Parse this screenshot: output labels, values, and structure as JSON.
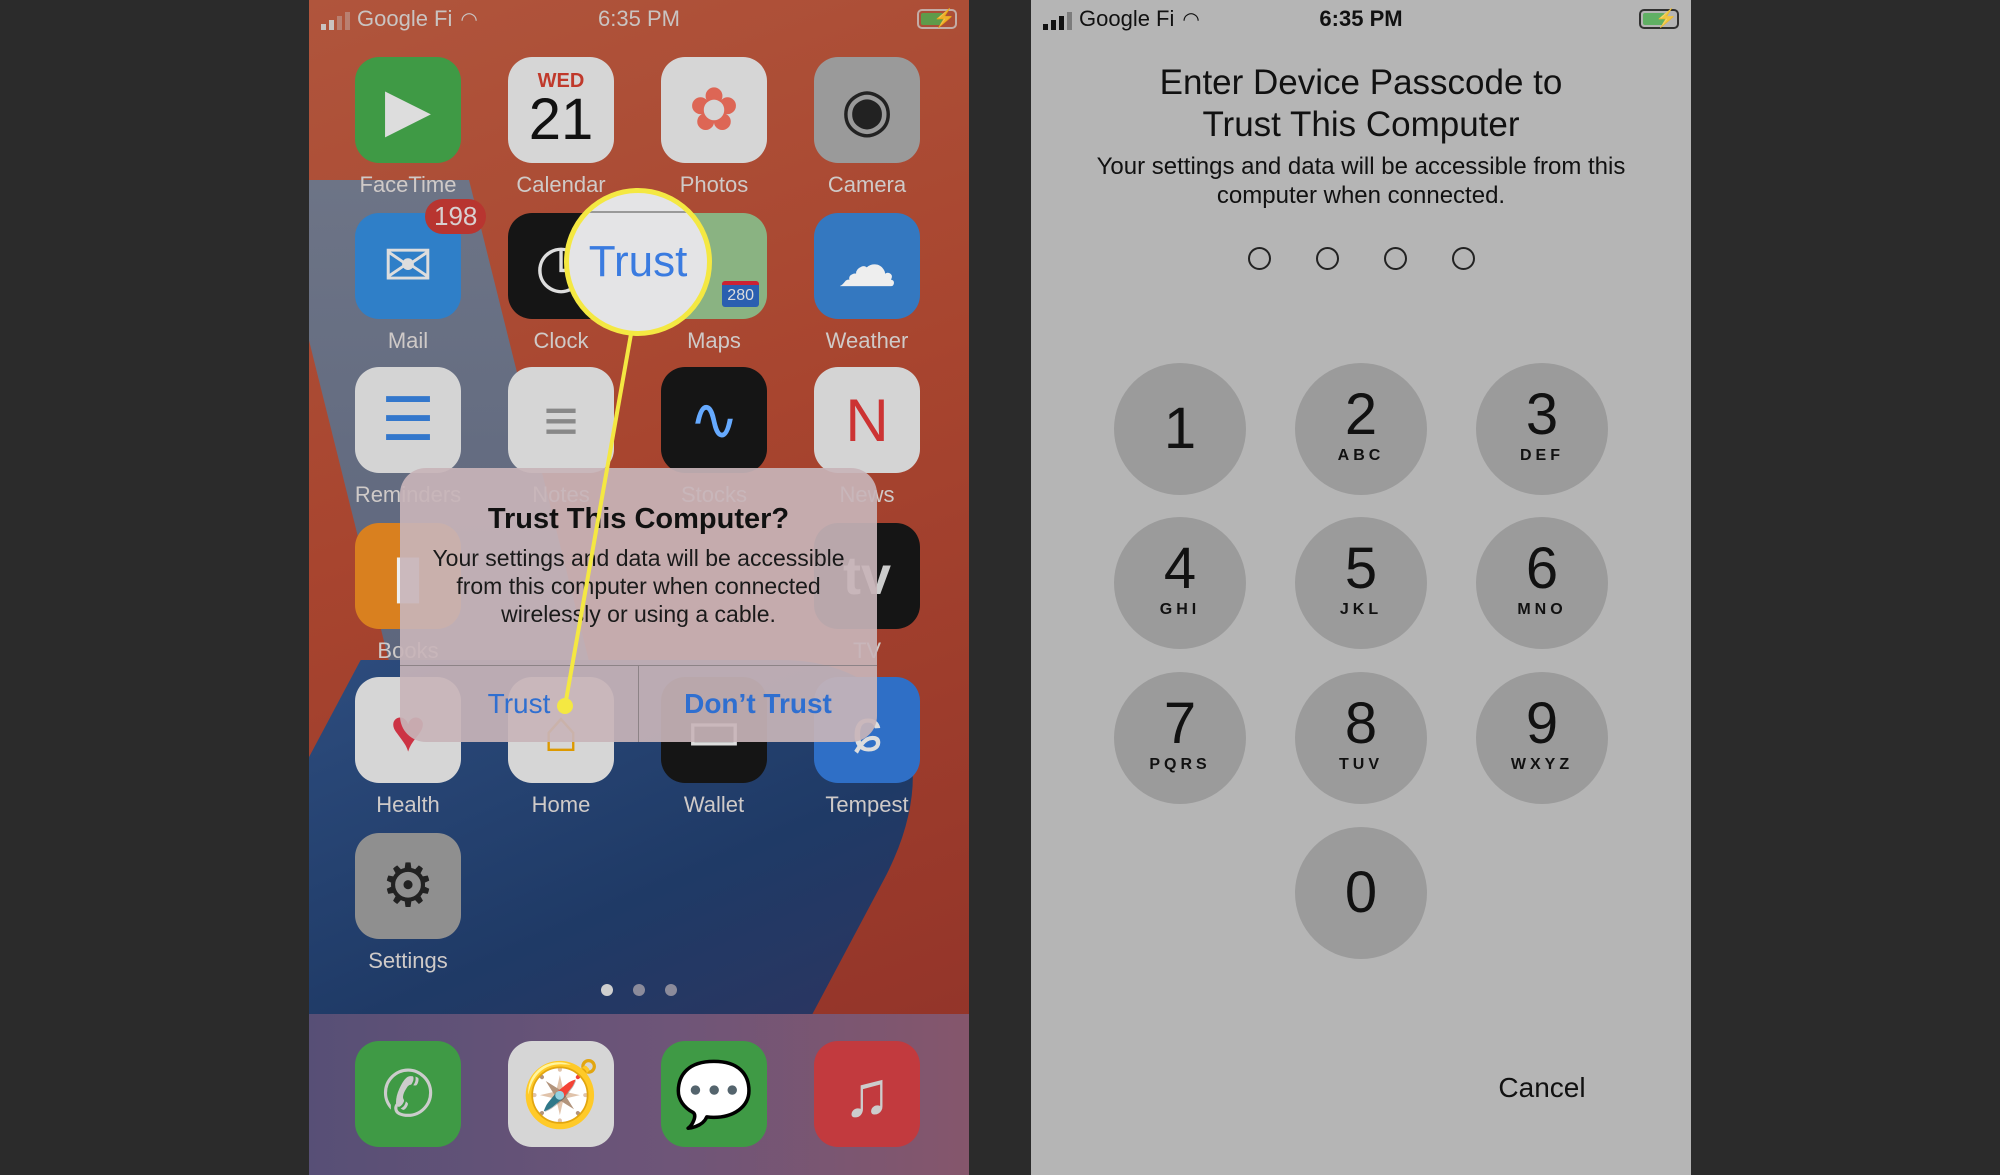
{
  "left_phone": {
    "status": {
      "carrier": "Google Fi",
      "time": "6:35 PM"
    },
    "apps": [
      {
        "label": "FaceTime",
        "icon": "facetime-icon",
        "color": "#3f9a45"
      },
      {
        "label": "Calendar",
        "icon": "calendar-icon",
        "color": "#d6d6d6",
        "day": "WED",
        "date": "21"
      },
      {
        "label": "Photos",
        "icon": "photos-icon",
        "color": "#d6d6d6"
      },
      {
        "label": "Camera",
        "icon": "camera-icon",
        "color": "#9a9a9a"
      },
      {
        "label": "Mail",
        "icon": "mail-icon",
        "color": "#2f7fc8",
        "badge": "198"
      },
      {
        "label": "Clock",
        "icon": "clock-icon",
        "color": "#151515"
      },
      {
        "label": "Maps",
        "icon": "maps-icon",
        "color": "#8ab382",
        "shield": "280"
      },
      {
        "label": "Weather",
        "icon": "weather-icon",
        "color": "#3478c0"
      },
      {
        "label": "Reminders",
        "icon": "reminders-icon",
        "color": "#d4d4d4"
      },
      {
        "label": "Notes",
        "icon": "notes-icon",
        "color": "#d6d6d6"
      },
      {
        "label": "Stocks",
        "icon": "stocks-icon",
        "color": "#151515"
      },
      {
        "label": "News",
        "icon": "news-icon",
        "color": "#d4d4d4"
      },
      {
        "label": "Books",
        "icon": "books-icon",
        "color": "#d9801f"
      },
      {
        "label": "",
        "icon": "hidden-app-icon",
        "color": "#888"
      },
      {
        "label": "",
        "icon": "hidden-app-icon",
        "color": "#888"
      },
      {
        "label": "TV",
        "icon": "tv-icon",
        "color": "#151515",
        "text": "tv"
      },
      {
        "label": "Health",
        "icon": "health-icon",
        "color": "#d6d6d6"
      },
      {
        "label": "Home",
        "icon": "home-icon",
        "color": "#d6d6d6"
      },
      {
        "label": "Wallet",
        "icon": "wallet-icon",
        "color": "#151515"
      },
      {
        "label": "Tempest",
        "icon": "tempest-icon",
        "color": "#2f6fc6"
      },
      {
        "label": "Settings",
        "icon": "settings-icon",
        "color": "#8f8f8f"
      }
    ],
    "dock": [
      {
        "icon": "phone-icon",
        "color": "#3f9a45"
      },
      {
        "icon": "safari-icon",
        "color": "#d6d6d6"
      },
      {
        "icon": "messages-icon",
        "color": "#3f9a45"
      },
      {
        "icon": "music-icon",
        "color": "#c23a3e"
      }
    ],
    "page_dots": 3,
    "dialog": {
      "title": "Trust This Computer?",
      "body": "Your settings and data will be accessible from this computer when connected wirelessly or using a cable.",
      "trust": "Trust",
      "dont_trust": "Don’t Trust"
    },
    "callout": {
      "text": "Trust",
      "color": "#f4e842"
    }
  },
  "right_phone": {
    "status": {
      "carrier": "Google Fi",
      "time": "6:35 PM"
    },
    "title": "Enter Device Passcode to Trust This Computer",
    "subtitle": "Your settings and data will be accessible from this computer when connected.",
    "passcode_length": 4,
    "keys": [
      {
        "n": "1",
        "l": ""
      },
      {
        "n": "2",
        "l": "ABC"
      },
      {
        "n": "3",
        "l": "DEF"
      },
      {
        "n": "4",
        "l": "GHI"
      },
      {
        "n": "5",
        "l": "JKL"
      },
      {
        "n": "6",
        "l": "MNO"
      },
      {
        "n": "7",
        "l": "PQRS"
      },
      {
        "n": "8",
        "l": "TUV"
      },
      {
        "n": "9",
        "l": "WXYZ"
      },
      {
        "n": "0",
        "l": ""
      }
    ],
    "cancel": "Cancel"
  }
}
